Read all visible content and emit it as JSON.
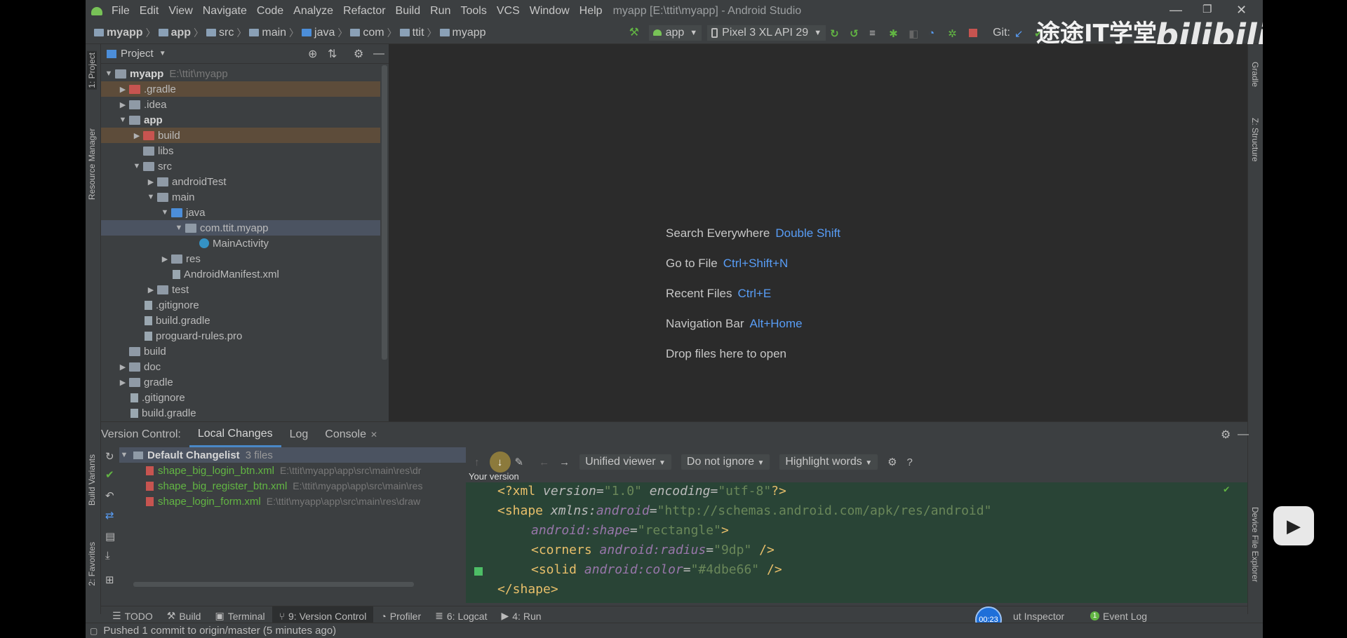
{
  "menu": [
    "File",
    "Edit",
    "View",
    "Navigate",
    "Code",
    "Analyze",
    "Refactor",
    "Build",
    "Run",
    "Tools",
    "VCS",
    "Window",
    "Help"
  ],
  "window_title": "myapp [E:\\ttit\\myapp] - Android Studio",
  "breadcrumbs": [
    "myapp",
    "app",
    "src",
    "main",
    "java",
    "com",
    "ttit",
    "myapp"
  ],
  "run_config": "app",
  "device": "Pixel 3 XL API 29",
  "git_label": "Git:",
  "watermark": {
    "text": "途途IT学堂",
    "brand": "bilibili"
  },
  "left_tabs": [
    "1: Project",
    "Resource Manager",
    "Build Variants",
    "2: Favorites"
  ],
  "right_tabs": [
    "Gradle",
    "Z: Structure",
    "Device File Explorer"
  ],
  "project": {
    "header": "Project",
    "tree": [
      {
        "label": "myapp",
        "extra": "E:\\ttit\\myapp",
        "level": 0,
        "arrow": "▼",
        "icon": "grey",
        "bold": true
      },
      {
        "label": ".gradle",
        "level": 1,
        "arrow": "▶",
        "icon": "red",
        "hl": "brown"
      },
      {
        "label": ".idea",
        "level": 1,
        "arrow": "▶",
        "icon": "grey"
      },
      {
        "label": "app",
        "level": 1,
        "arrow": "▼",
        "icon": "grey",
        "bold": true
      },
      {
        "label": "build",
        "level": 2,
        "arrow": "▶",
        "icon": "red",
        "hl": "brown"
      },
      {
        "label": "libs",
        "level": 2,
        "arrow": "",
        "icon": "grey"
      },
      {
        "label": "src",
        "level": 2,
        "arrow": "▼",
        "icon": "grey"
      },
      {
        "label": "androidTest",
        "level": 3,
        "arrow": "▶",
        "icon": "grey"
      },
      {
        "label": "main",
        "level": 3,
        "arrow": "▼",
        "icon": "grey"
      },
      {
        "label": "java",
        "level": 4,
        "arrow": "▼",
        "icon": "blue"
      },
      {
        "label": "com.ttit.myapp",
        "level": 5,
        "arrow": "▼",
        "icon": "grey",
        "hl": "sel"
      },
      {
        "label": "MainActivity",
        "level": 6,
        "arrow": "",
        "icon": "class"
      },
      {
        "label": "res",
        "level": 4,
        "arrow": "▶",
        "icon": "grey"
      },
      {
        "label": "AndroidManifest.xml",
        "level": 4,
        "arrow": "",
        "icon": "file"
      },
      {
        "label": "test",
        "level": 3,
        "arrow": "▶",
        "icon": "grey"
      },
      {
        "label": ".gitignore",
        "level": 2,
        "arrow": "",
        "icon": "file"
      },
      {
        "label": "build.gradle",
        "level": 2,
        "arrow": "",
        "icon": "file"
      },
      {
        "label": "proguard-rules.pro",
        "level": 2,
        "arrow": "",
        "icon": "file"
      },
      {
        "label": "build",
        "level": 1,
        "arrow": "",
        "icon": "grey"
      },
      {
        "label": "doc",
        "level": 1,
        "arrow": "▶",
        "icon": "grey"
      },
      {
        "label": "gradle",
        "level": 1,
        "arrow": "▶",
        "icon": "grey"
      },
      {
        "label": ".gitignore",
        "level": 1,
        "arrow": "",
        "icon": "file"
      },
      {
        "label": "build.gradle",
        "level": 1,
        "arrow": "",
        "icon": "file"
      }
    ]
  },
  "editor_hints": [
    {
      "label": "Search Everywhere",
      "key": "Double Shift"
    },
    {
      "label": "Go to File",
      "key": "Ctrl+Shift+N"
    },
    {
      "label": "Recent Files",
      "key": "Ctrl+E"
    },
    {
      "label": "Navigation Bar",
      "key": "Alt+Home"
    },
    {
      "label": "Drop files here to open",
      "key": ""
    }
  ],
  "vc": {
    "title": "Version Control:",
    "tabs": [
      "Local Changes",
      "Log",
      "Console"
    ],
    "changelist": "Default Changelist",
    "count": "3 files",
    "files": [
      {
        "name": "shape_big_login_btn.xml",
        "path": "E:\\ttit\\myapp\\app\\src\\main\\res\\dr"
      },
      {
        "name": "shape_big_register_btn.xml",
        "path": "E:\\ttit\\myapp\\app\\src\\main\\res"
      },
      {
        "name": "shape_login_form.xml",
        "path": "E:\\ttit\\myapp\\app\\src\\main\\res\\draw"
      }
    ],
    "viewer": "Unified viewer",
    "ignore": "Do not ignore",
    "highlight": "Highlight words",
    "tooltip": "Your version"
  },
  "code": {
    "l1": {
      "a": "<?xml ",
      "b": "version",
      "c": "=",
      "d": "\"1.0\"",
      "e": " ",
      "f": "encoding",
      "g": "=",
      "h": "\"utf-8\"",
      "i": "?>"
    },
    "l2": {
      "a": "<shape ",
      "b": "xmlns:",
      "c": "android",
      "d": "=",
      "e": "\"http://schemas.android.com/apk/res/android\""
    },
    "l3": {
      "a": "android:",
      "b": "shape",
      "c": "=",
      "d": "\"rectangle\"",
      "e": ">"
    },
    "l4": {
      "a": "<corners ",
      "b": "android:",
      "c": "radius",
      "d": "=",
      "e": "\"9dp\"",
      "f": " />"
    },
    "l5": {
      "a": "<solid ",
      "b": "android:",
      "c": "color",
      "d": "=",
      "e": "\"#4dbe66\"",
      "f": " />"
    },
    "l6": {
      "a": "</shape>"
    }
  },
  "toolwindows": [
    "TODO",
    "Build",
    "Terminal",
    "9: Version Control",
    "Profiler",
    "6: Logcat",
    "4: Run"
  ],
  "toolwindows_right": [
    "ut Inspector",
    "Event Log"
  ],
  "timer": "00:23",
  "status": "Pushed 1 commit to origin/master (5 minutes ago)",
  "colors": {
    "accent": "#4a88c7",
    "diff_bg": "#294436",
    "file_added": "#62b543"
  }
}
